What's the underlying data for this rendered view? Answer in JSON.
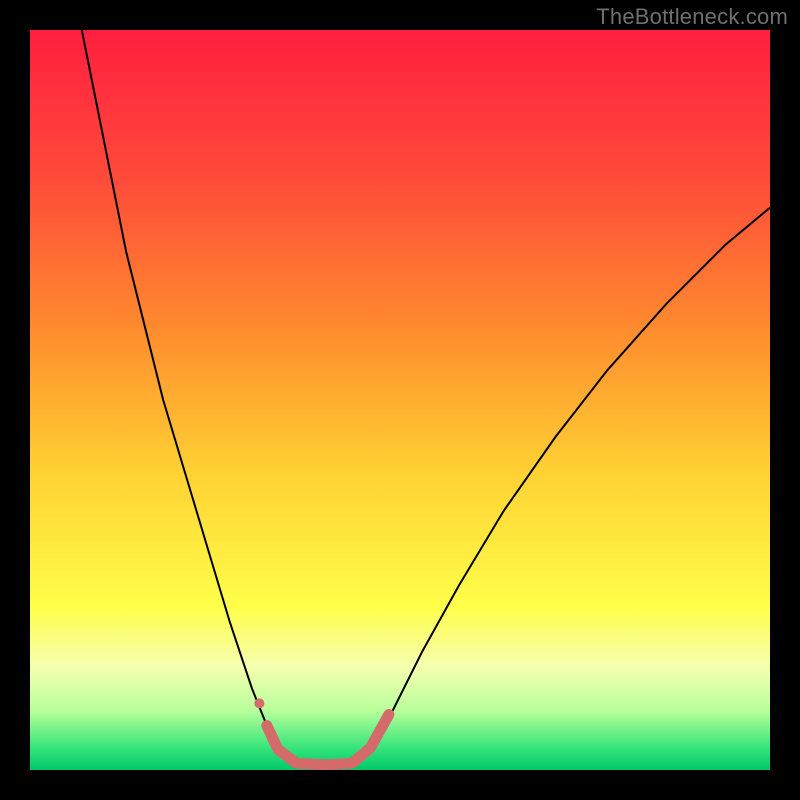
{
  "watermark": "TheBottleneck.com",
  "chart_data": {
    "type": "line",
    "title": "",
    "xlabel": "",
    "ylabel": "",
    "xlim": [
      0,
      100
    ],
    "ylim": [
      0,
      100
    ],
    "gradient_stops": [
      {
        "offset": 0,
        "color": "#ff1f3f"
      },
      {
        "offset": 20,
        "color": "#ff4a3a"
      },
      {
        "offset": 40,
        "color": "#ff8a2e"
      },
      {
        "offset": 60,
        "color": "#ffd233"
      },
      {
        "offset": 78,
        "color": "#ffff4a"
      },
      {
        "offset": 86,
        "color": "#f6ffb0"
      },
      {
        "offset": 92,
        "color": "#b8ff9a"
      },
      {
        "offset": 97,
        "color": "#36e57a"
      },
      {
        "offset": 100,
        "color": "#00c86a"
      }
    ],
    "series": [
      {
        "name": "curve-left",
        "stroke": "#000000",
        "stroke_width": 2.0,
        "points": [
          {
            "x": 7.0,
            "y": 100.0
          },
          {
            "x": 9.0,
            "y": 90.0
          },
          {
            "x": 11.0,
            "y": 80.0
          },
          {
            "x": 13.0,
            "y": 70.0
          },
          {
            "x": 15.5,
            "y": 60.0
          },
          {
            "x": 18.0,
            "y": 50.0
          },
          {
            "x": 21.0,
            "y": 40.0
          },
          {
            "x": 24.0,
            "y": 30.0
          },
          {
            "x": 27.0,
            "y": 20.0
          },
          {
            "x": 30.0,
            "y": 11.0
          },
          {
            "x": 32.0,
            "y": 6.0
          },
          {
            "x": 34.0,
            "y": 2.5
          },
          {
            "x": 36.0,
            "y": 0.8
          }
        ]
      },
      {
        "name": "curve-right",
        "stroke": "#000000",
        "stroke_width": 2.0,
        "points": [
          {
            "x": 44.0,
            "y": 0.8
          },
          {
            "x": 46.0,
            "y": 3.0
          },
          {
            "x": 49.0,
            "y": 8.0
          },
          {
            "x": 53.0,
            "y": 16.0
          },
          {
            "x": 58.0,
            "y": 25.0
          },
          {
            "x": 64.0,
            "y": 35.0
          },
          {
            "x": 71.0,
            "y": 45.0
          },
          {
            "x": 78.0,
            "y": 54.0
          },
          {
            "x": 86.0,
            "y": 63.0
          },
          {
            "x": 94.0,
            "y": 71.0
          },
          {
            "x": 100.0,
            "y": 76.0
          }
        ]
      },
      {
        "name": "valley-highlight",
        "stroke": "#d46a6a",
        "stroke_width": 11,
        "linecap": "round",
        "points": [
          {
            "x": 32.0,
            "y": 6.0
          },
          {
            "x": 33.5,
            "y": 2.8
          },
          {
            "x": 36.0,
            "y": 0.9
          },
          {
            "x": 40.0,
            "y": 0.7
          },
          {
            "x": 43.5,
            "y": 0.9
          },
          {
            "x": 46.0,
            "y": 3.0
          },
          {
            "x": 48.5,
            "y": 7.5
          }
        ]
      }
    ],
    "markers": [
      {
        "name": "valley-dot",
        "x": 31.0,
        "y": 9.0,
        "r": 5,
        "fill": "#d46a6a"
      }
    ]
  }
}
